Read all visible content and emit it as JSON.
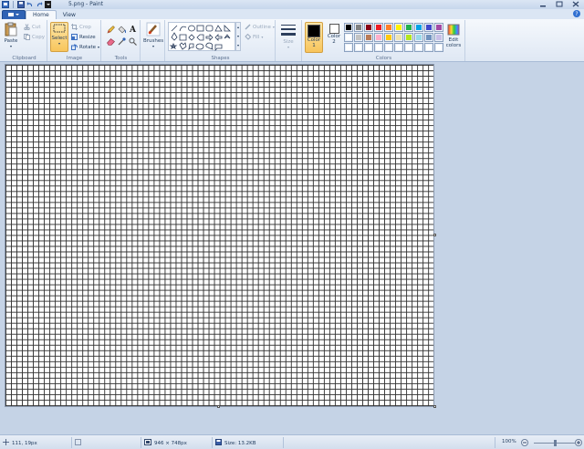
{
  "titlebar": {
    "title": "5.png - Paint",
    "icons": [
      "paint-app-icon",
      "save-icon",
      "undo-icon",
      "redo-icon",
      "customize-qat-icon"
    ],
    "controls": [
      "minimize",
      "maximize",
      "close"
    ]
  },
  "tabs": {
    "file_icon": "paint-menu-icon",
    "items": [
      {
        "label": "Home",
        "active": true
      },
      {
        "label": "View",
        "active": false
      }
    ],
    "help_icon": "?"
  },
  "ribbon": {
    "clipboard": {
      "label": "Clipboard",
      "paste": "Paste",
      "cut": "Cut",
      "copy": "Copy"
    },
    "image": {
      "label": "Image",
      "select": "Select",
      "crop": "Crop",
      "resize": "Resize",
      "rotate": "Rotate"
    },
    "tools": {
      "label": "Tools",
      "items": [
        "pencil-icon",
        "fill-icon",
        "text-icon",
        "eraser-icon",
        "color-picker-icon",
        "magnifier-icon"
      ]
    },
    "brushes": {
      "label": "Brushes"
    },
    "shapes": {
      "label": "Shapes",
      "outline": "Outline",
      "fill": "Fill"
    },
    "size": {
      "label": "Size"
    },
    "colors": {
      "label": "Colors",
      "color1": "Color\n1",
      "color1_a": "Color",
      "color1_b": "1",
      "color2_a": "Color",
      "color2_b": "2",
      "edit_a": "Edit",
      "edit_b": "colors",
      "color1_value": "#000000",
      "color2_value": "#ffffff",
      "palette_row1": [
        "#000000",
        "#7f7f7f",
        "#880015",
        "#ed1c24",
        "#ff7f27",
        "#fff200",
        "#22b14c",
        "#00a2e8",
        "#3f48cc",
        "#a349a4"
      ],
      "palette_row2": [
        "#ffffff",
        "#c3c3c3",
        "#b97a57",
        "#ffaec9",
        "#ffc90e",
        "#efe4b0",
        "#b5e61d",
        "#99d9ea",
        "#7092be",
        "#c8bfe7"
      ],
      "palette_row3": [
        "#ffffff",
        "#ffffff",
        "#ffffff",
        "#ffffff",
        "#ffffff",
        "#ffffff",
        "#ffffff",
        "#ffffff",
        "#ffffff",
        "#ffffff"
      ]
    }
  },
  "status": {
    "cursor_pos": "111, 19px",
    "selection_size": "",
    "image_size": "946 × 748px",
    "file_size": "Size: 13.2KB",
    "zoom": "100%",
    "zoom_level": 1.0
  }
}
